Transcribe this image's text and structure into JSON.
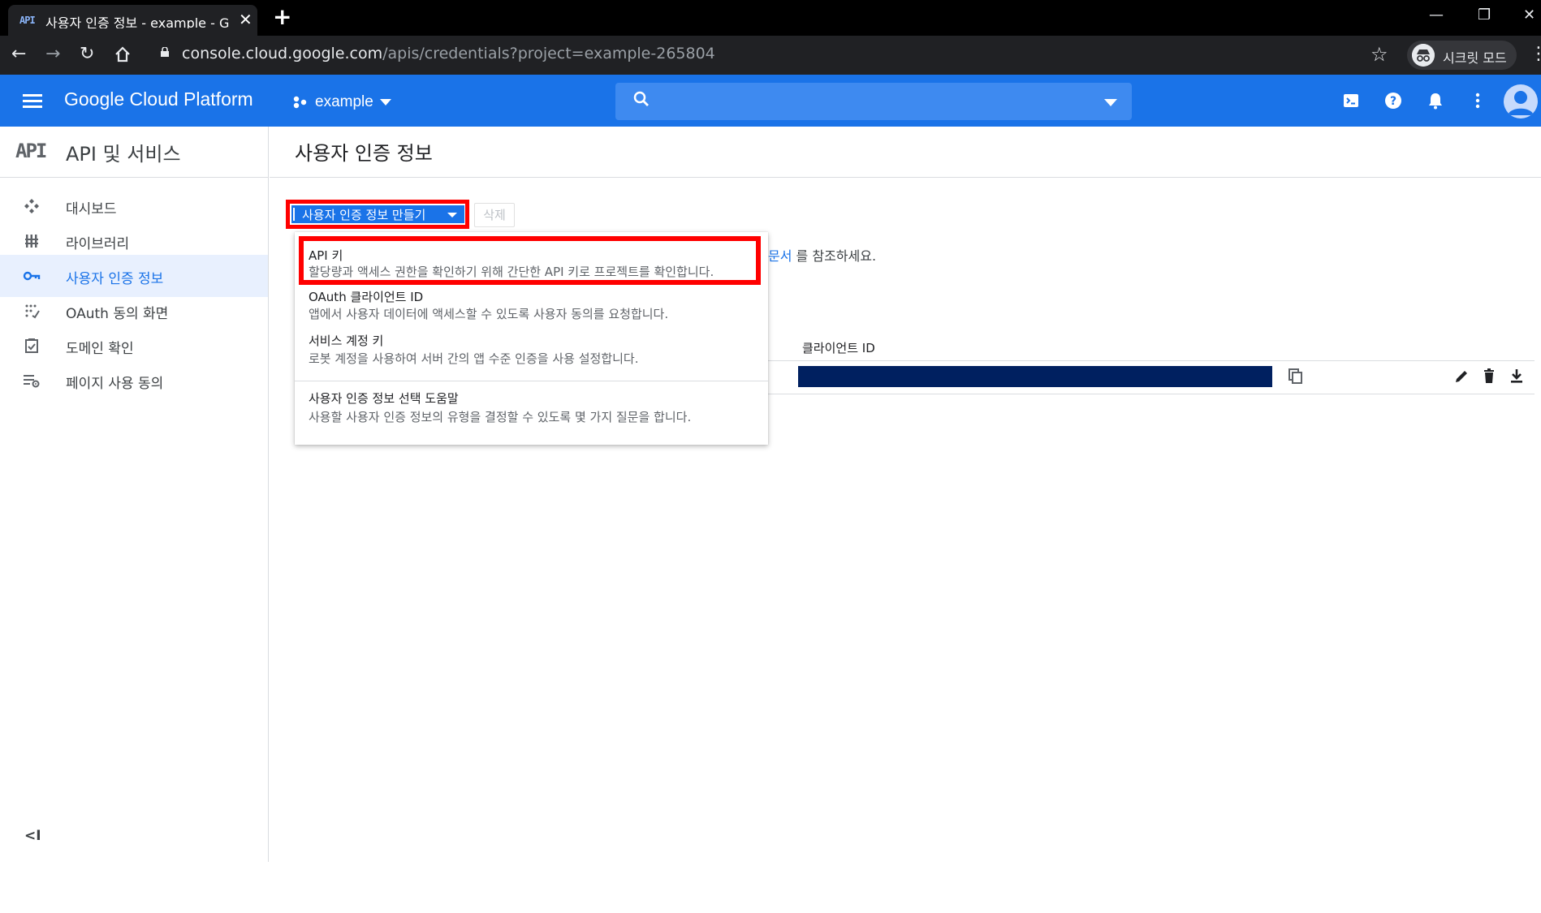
{
  "browser": {
    "tab_favicon": "API",
    "tab_title": "사용자 인증 정보 - example - G",
    "url_host": "console.cloud.google.com",
    "url_path": "/apis/credentials?project=example-265804",
    "incognito_label": "시크릿 모드"
  },
  "header": {
    "product_name": "Google Cloud Platform",
    "project_name": "example",
    "brand_color": "#1a73e8"
  },
  "sidebar": {
    "logo_text": "API",
    "title": "API 및 서비스",
    "items": [
      {
        "label": "대시보드",
        "icon": "dashboard-icon"
      },
      {
        "label": "라이브러리",
        "icon": "library-icon"
      },
      {
        "label": "사용자 인증 정보",
        "icon": "key-icon",
        "active": true
      },
      {
        "label": "OAuth 동의 화면",
        "icon": "oauth-consent-icon"
      },
      {
        "label": "도메인 확인",
        "icon": "domain-verify-icon"
      },
      {
        "label": "페이지 사용 동의",
        "icon": "page-usage-icon"
      }
    ],
    "collapse_label": "<I"
  },
  "main": {
    "page_title": "사용자 인증 정보",
    "create_button": "사용자 인증 정보 만들기",
    "delete_button": "삭제",
    "info_link": "문서",
    "info_suffix": " 를 참조하세요.",
    "table_column_client_id": "클라이언트 ID"
  },
  "menu": {
    "items": [
      {
        "title": "API 키",
        "desc": "할당량과 액세스 권한을 확인하기 위해 간단한 API 키로 프로젝트를 확인합니다."
      },
      {
        "title": "OAuth 클라이언트 ID",
        "desc": "앱에서 사용자 데이터에 액세스할 수 있도록 사용자 동의를 요청합니다."
      },
      {
        "title": "서비스 계정 키",
        "desc": "로봇 계정을 사용하여 서버 간의 앱 수준 인증을 사용 설정합니다."
      },
      {
        "title": "사용자 인증 정보 선택 도움말",
        "desc": "사용할 사용자 인증 정보의 유형을 결정할 수 있도록 몇 가지 질문을 합니다."
      }
    ]
  },
  "highlight_color": "#ff0000"
}
